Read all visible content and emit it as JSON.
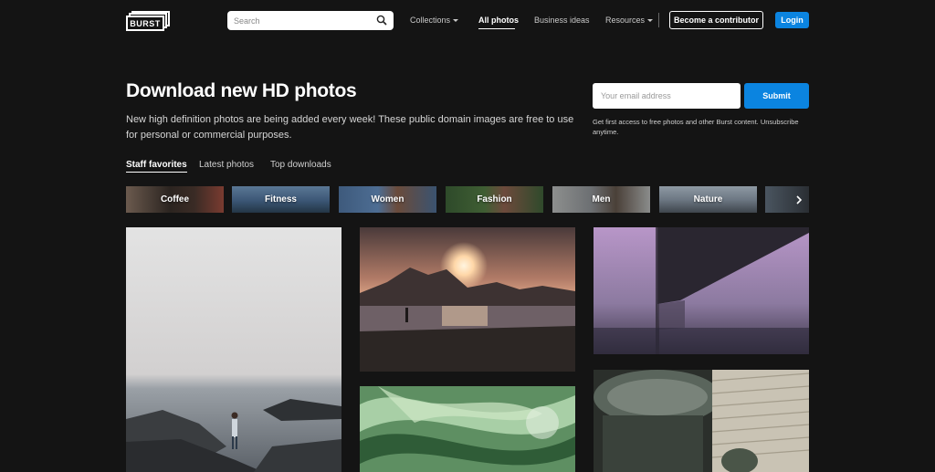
{
  "header": {
    "logo_text": "BURST",
    "search_placeholder": "Search",
    "nav": [
      {
        "label": "Collections",
        "caret": true
      },
      {
        "label": "All photos",
        "active": true
      },
      {
        "label": "Business ideas"
      },
      {
        "label": "Resources",
        "caret": true
      }
    ],
    "contributor_label": "Become a contributor",
    "login_label": "Login"
  },
  "hero": {
    "title": "Download new HD photos",
    "subtitle": "New high definition photos are being added every week! These public domain images are free to use for personal or commercial purposes.",
    "email_placeholder": "Your email address",
    "submit_label": "Submit",
    "email_note": "Get first access to free photos and other Burst content. Unsubscribe anytime."
  },
  "tabs": [
    "Staff favorites",
    "Latest photos",
    "Top downloads"
  ],
  "categories": [
    "Coffee",
    "Fitness",
    "Women",
    "Fashion",
    "Men",
    "Nature"
  ],
  "photos": [
    "Woman standing on rocks by the sea",
    "Sunset over beach with mountains",
    "Purple fog under bridge",
    "Green swirl abstract",
    "Glass jar and knit texture"
  ],
  "colors": {
    "background": "#141414",
    "accent": "#0b84e0"
  },
  "icons": {
    "search": "search-icon",
    "caret": "chevron-down-icon",
    "next": "chevron-right-icon"
  }
}
